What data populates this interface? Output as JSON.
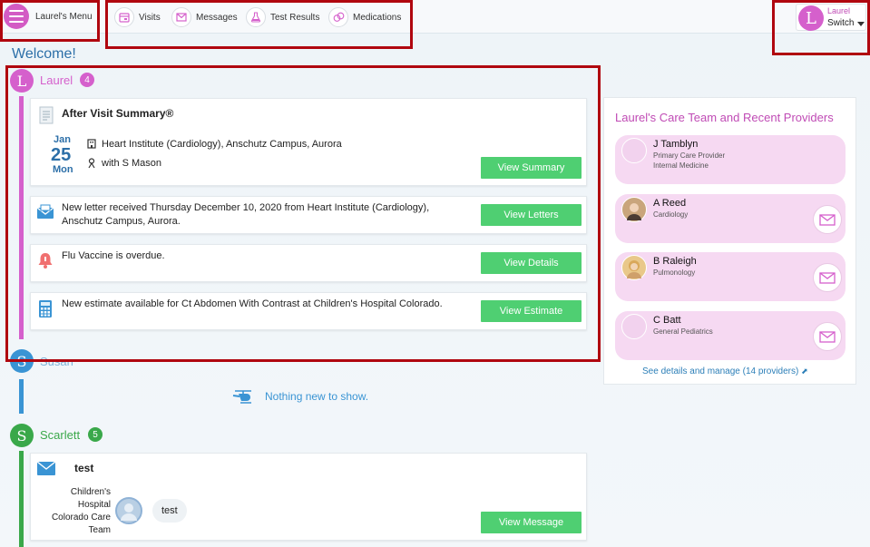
{
  "nav": {
    "menu_label": "Laurel's Menu",
    "items": [
      {
        "label": "Visits",
        "icon": "calendar-icon"
      },
      {
        "label": "Messages",
        "icon": "envelope-icon"
      },
      {
        "label": "Test Results",
        "icon": "flask-icon"
      },
      {
        "label": "Medications",
        "icon": "pills-icon"
      }
    ],
    "user": {
      "initial": "L",
      "name": "Laurel",
      "switch_label": "Switch"
    }
  },
  "welcome": "Welcome!",
  "people": [
    {
      "initial": "L",
      "name": "Laurel",
      "count": "4",
      "color": "#d560cc"
    },
    {
      "initial": "S",
      "name": "Susan",
      "color": "#3a94d4"
    },
    {
      "initial": "S",
      "name": "Scarlett",
      "count": "5",
      "color": "#3aa84a"
    }
  ],
  "laurel_cards": {
    "avs": {
      "title": "After Visit Summary®",
      "month": "Jan",
      "day": "25",
      "weekday": "Mon",
      "location": "Heart Institute (Cardiology), Anschutz Campus, Aurora",
      "provider": "with S Mason",
      "button": "View Summary"
    },
    "letter": {
      "text": "New letter received Thursday December 10, 2020 from Heart Institute (Cardiology), Anschutz Campus, Aurora.",
      "button": "View Letters"
    },
    "flu": {
      "text": "Flu Vaccine is overdue.",
      "button": "View Details"
    },
    "estimate": {
      "text": "New estimate available for Ct Abdomen With Contrast at Children's Hospital Colorado.",
      "button": "View Estimate"
    }
  },
  "susan": {
    "nothing": "Nothing new to show."
  },
  "scarlett_card": {
    "title": "test",
    "sender": "Children's Hospital Colorado Care Team",
    "message": "test",
    "button": "View Message"
  },
  "care_team": {
    "title": "Laurel's Care Team and Recent Providers",
    "providers": [
      {
        "name": "J Tamblyn",
        "line1": "Primary Care Provider",
        "line2": "Internal Medicine"
      },
      {
        "name": "A Reed",
        "line1": "Cardiology"
      },
      {
        "name": "B Raleigh",
        "line1": "Pulmonology"
      },
      {
        "name": "C Batt",
        "line1": "General Pediatrics"
      }
    ],
    "see_details": "See details and manage (14 providers)"
  },
  "colors": {
    "accent": "#d560cc",
    "button": "#4fcf72",
    "highlight_box": "#b0060f"
  }
}
